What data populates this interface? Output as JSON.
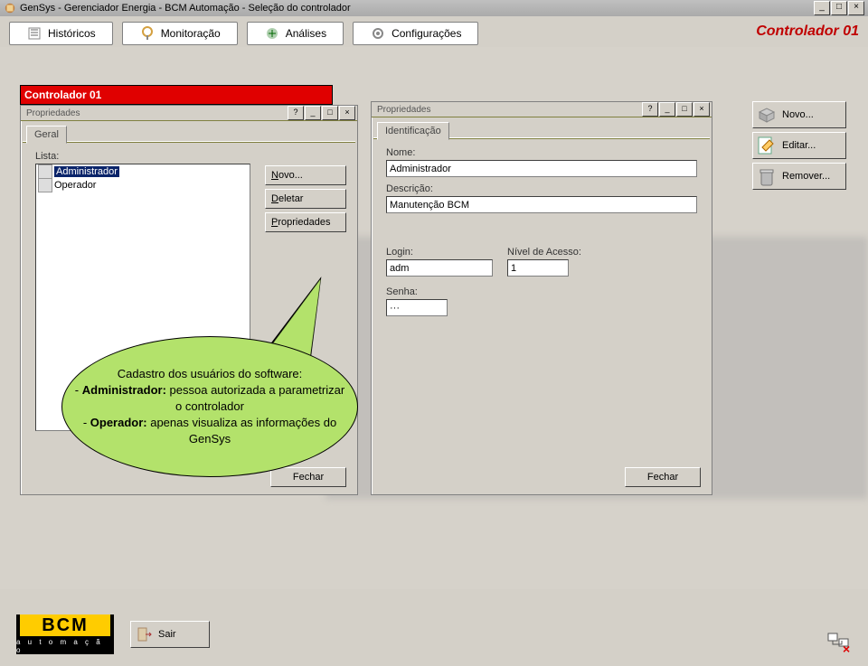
{
  "window": {
    "title": "GenSys - Gerenciador Energia - BCM Automação - Seleção do controlador"
  },
  "toolbar": {
    "historicos": "Históricos",
    "monitoracao": "Monitoração",
    "analises": "Análises",
    "configuracoes": "Configurações",
    "controller_label": "Controlador 01"
  },
  "redbar": {
    "text": "Controlador 01"
  },
  "panel1": {
    "title": "Propriedades",
    "tab": "Geral",
    "list_label": "Lista:",
    "items": [
      "Administrador",
      "Operador"
    ],
    "btn_novo": "Novo...",
    "btn_deletar": "Deletar",
    "btn_prop": "Propriedades",
    "btn_fechar": "Fechar"
  },
  "panel2": {
    "title": "Propriedades",
    "tab": "Identificação",
    "nome_lbl": "Nome:",
    "nome_val": "Administrador",
    "desc_lbl": "Descrição:",
    "desc_val": "Manutenção BCM",
    "login_lbl": "Login:",
    "login_val": "adm",
    "nivel_lbl": "Nível de Acesso:",
    "nivel_val": "1",
    "senha_lbl": "Senha:",
    "senha_val": "···",
    "btn_fechar": "Fechar"
  },
  "right": {
    "novo": "Novo...",
    "editar": "Editar...",
    "remover": "Remover..."
  },
  "callout": {
    "l1": "Cadastro dos usuários do software:",
    "l2a": "- ",
    "l2b": "Administrador:",
    "l2c": " pessoa autorizada a parametrizar o controlador",
    "l3a": "- ",
    "l3b": "Operador:",
    "l3c": " apenas visualiza as informações do GenSys"
  },
  "footer": {
    "logo1": "BCM",
    "logo2": "a u t o m a ç ã o",
    "sair": "Sair"
  }
}
